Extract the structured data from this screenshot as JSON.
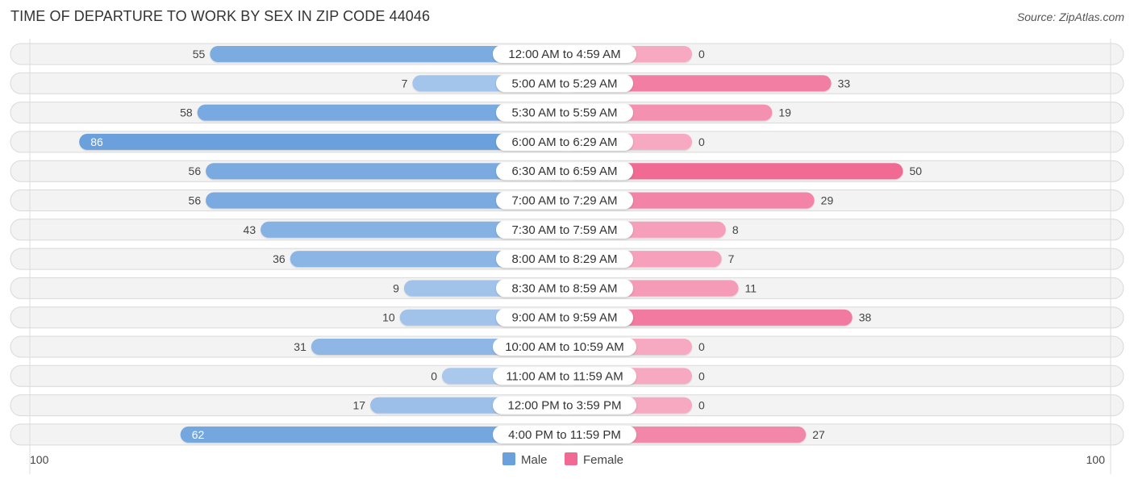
{
  "header": {
    "title": "TIME OF DEPARTURE TO WORK BY SEX IN ZIP CODE 44046",
    "source": "Source: ZipAtlas.com"
  },
  "colors": {
    "male": "#6aa0dc",
    "male_light": "#a9c8ec",
    "female": "#f06a94",
    "female_light": "#f7a9c1",
    "row_bg": "#f3f3f3"
  },
  "chart_data": {
    "type": "bar",
    "orientation": "horizontal-diverging",
    "title": "TIME OF DEPARTURE TO WORK BY SEX IN ZIP CODE 44046",
    "categories": [
      "12:00 AM to 4:59 AM",
      "5:00 AM to 5:29 AM",
      "5:30 AM to 5:59 AM",
      "6:00 AM to 6:29 AM",
      "6:30 AM to 6:59 AM",
      "7:00 AM to 7:29 AM",
      "7:30 AM to 7:59 AM",
      "8:00 AM to 8:29 AM",
      "8:30 AM to 8:59 AM",
      "9:00 AM to 9:59 AM",
      "10:00 AM to 10:59 AM",
      "11:00 AM to 11:59 AM",
      "12:00 PM to 3:59 PM",
      "4:00 PM to 11:59 PM"
    ],
    "series": [
      {
        "name": "Male",
        "values": [
          55,
          7,
          58,
          86,
          56,
          56,
          43,
          36,
          9,
          10,
          31,
          0,
          17,
          62
        ]
      },
      {
        "name": "Female",
        "values": [
          0,
          33,
          19,
          0,
          50,
          29,
          8,
          7,
          11,
          38,
          0,
          0,
          0,
          27
        ]
      }
    ],
    "axis": {
      "left_label": "100",
      "right_label": "100",
      "range": [
        0,
        100
      ]
    },
    "legend": {
      "position": "bottom-center",
      "entries": [
        "Male",
        "Female"
      ]
    },
    "grid": false
  }
}
